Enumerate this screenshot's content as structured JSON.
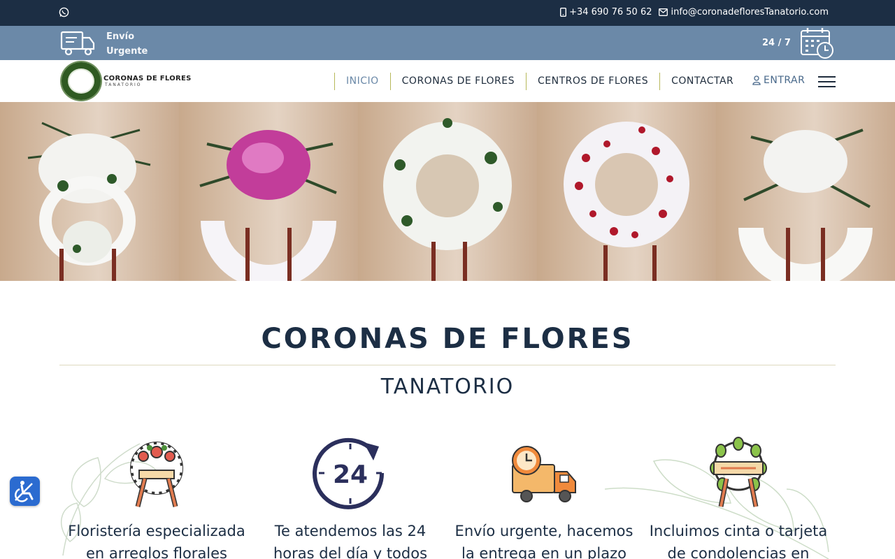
{
  "topbar": {
    "phone": "+34 690 76 50 62",
    "email": "info@coronadefloresTanatorio.com",
    "icons": [
      "whatsapp-icon",
      "mobile-phone-icon",
      "envelope-icon"
    ]
  },
  "band": {
    "urgent_line1": "Envío",
    "urgent_line2": "Urgente",
    "hours": "24 / 7"
  },
  "logo": {
    "title": "CORONAS DE FLORES",
    "subtitle": "TANATORIO"
  },
  "nav": {
    "items": [
      {
        "label": "INICIO",
        "active": true
      },
      {
        "label": "CORONAS DE FLORES"
      },
      {
        "label": "CENTROS DE FLORES"
      },
      {
        "label": "CONTACTAR"
      }
    ],
    "login": "ENTRAR"
  },
  "hero": {
    "title": "CORONAS DE FLORES",
    "subtitle": "TANATORIO"
  },
  "features": [
    {
      "line1": "Floristería especializada",
      "line2": "en arreglos florales",
      "icon": "funeral-wreath-icon"
    },
    {
      "line1": "Te atendemos las 24",
      "line2": "horas del día y todos",
      "icon": "24-hours-icon"
    },
    {
      "line1": "Envío urgente, hacemos",
      "line2": "la entrega en un plazo",
      "icon": "delivery-truck-icon"
    },
    {
      "line1": "Incluimos cinta o tarjeta",
      "line2": "de condolencias en",
      "icon": "laurel-wreath-icon"
    }
  ],
  "colors": {
    "topbar": "#1c2e44",
    "band": "#6b89a8",
    "accent_line": "#b7b85a",
    "heading": "#1c2e44"
  }
}
